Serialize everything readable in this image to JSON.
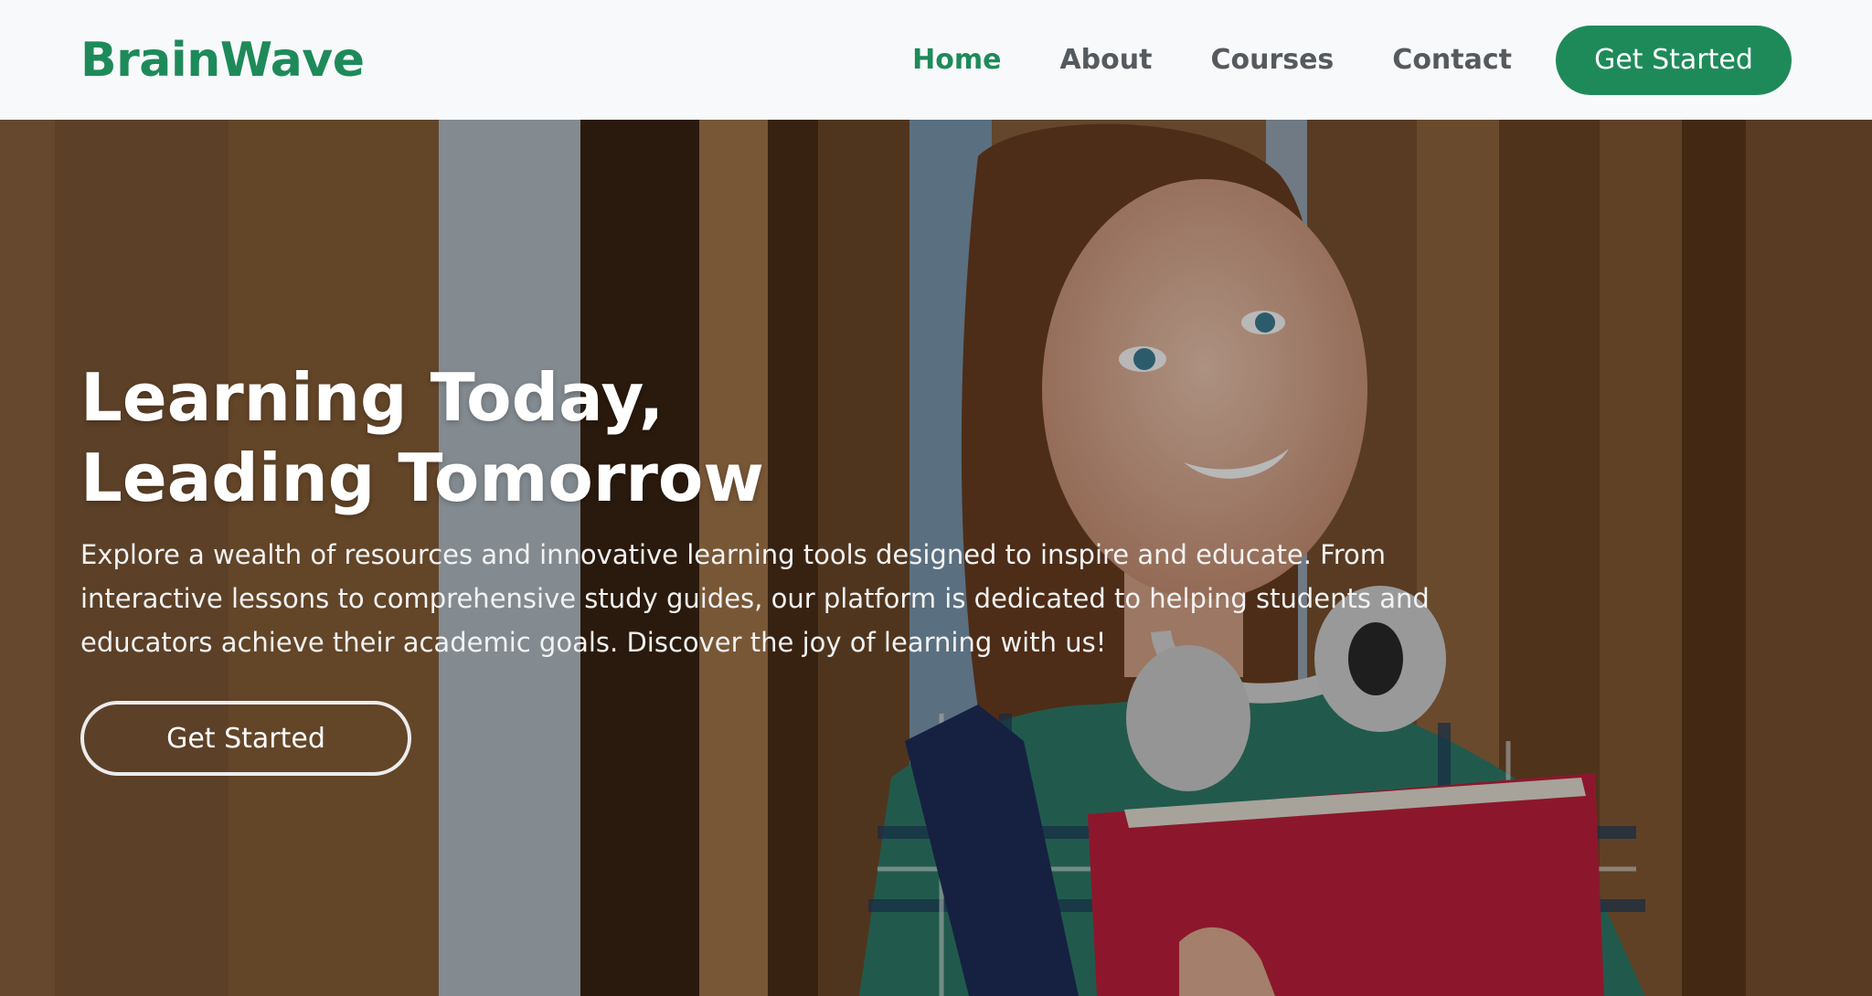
{
  "navbar": {
    "brand": "BrainWave",
    "links": [
      {
        "label": "Home",
        "active": true
      },
      {
        "label": "About",
        "active": false
      },
      {
        "label": "Courses",
        "active": false
      },
      {
        "label": "Contact",
        "active": false
      }
    ],
    "cta_label": "Get Started"
  },
  "hero": {
    "title_line1": "Learning Today,",
    "title_line2": "Leading Tomorrow",
    "description": "Explore a wealth of resources and innovative learning tools designed to inspire and educate. From interactive lessons to comprehensive study guides, our platform is dedicated to helping students and educators achieve their academic goals. Discover the joy of learning with us!",
    "cta_label": "Get Started",
    "background_image": "photo-student-with-headphones-and-red-folder"
  },
  "colors": {
    "brand": "#1e8a5a",
    "nav_text": "#555a5e",
    "navbar_bg": "#f8f9fb"
  }
}
